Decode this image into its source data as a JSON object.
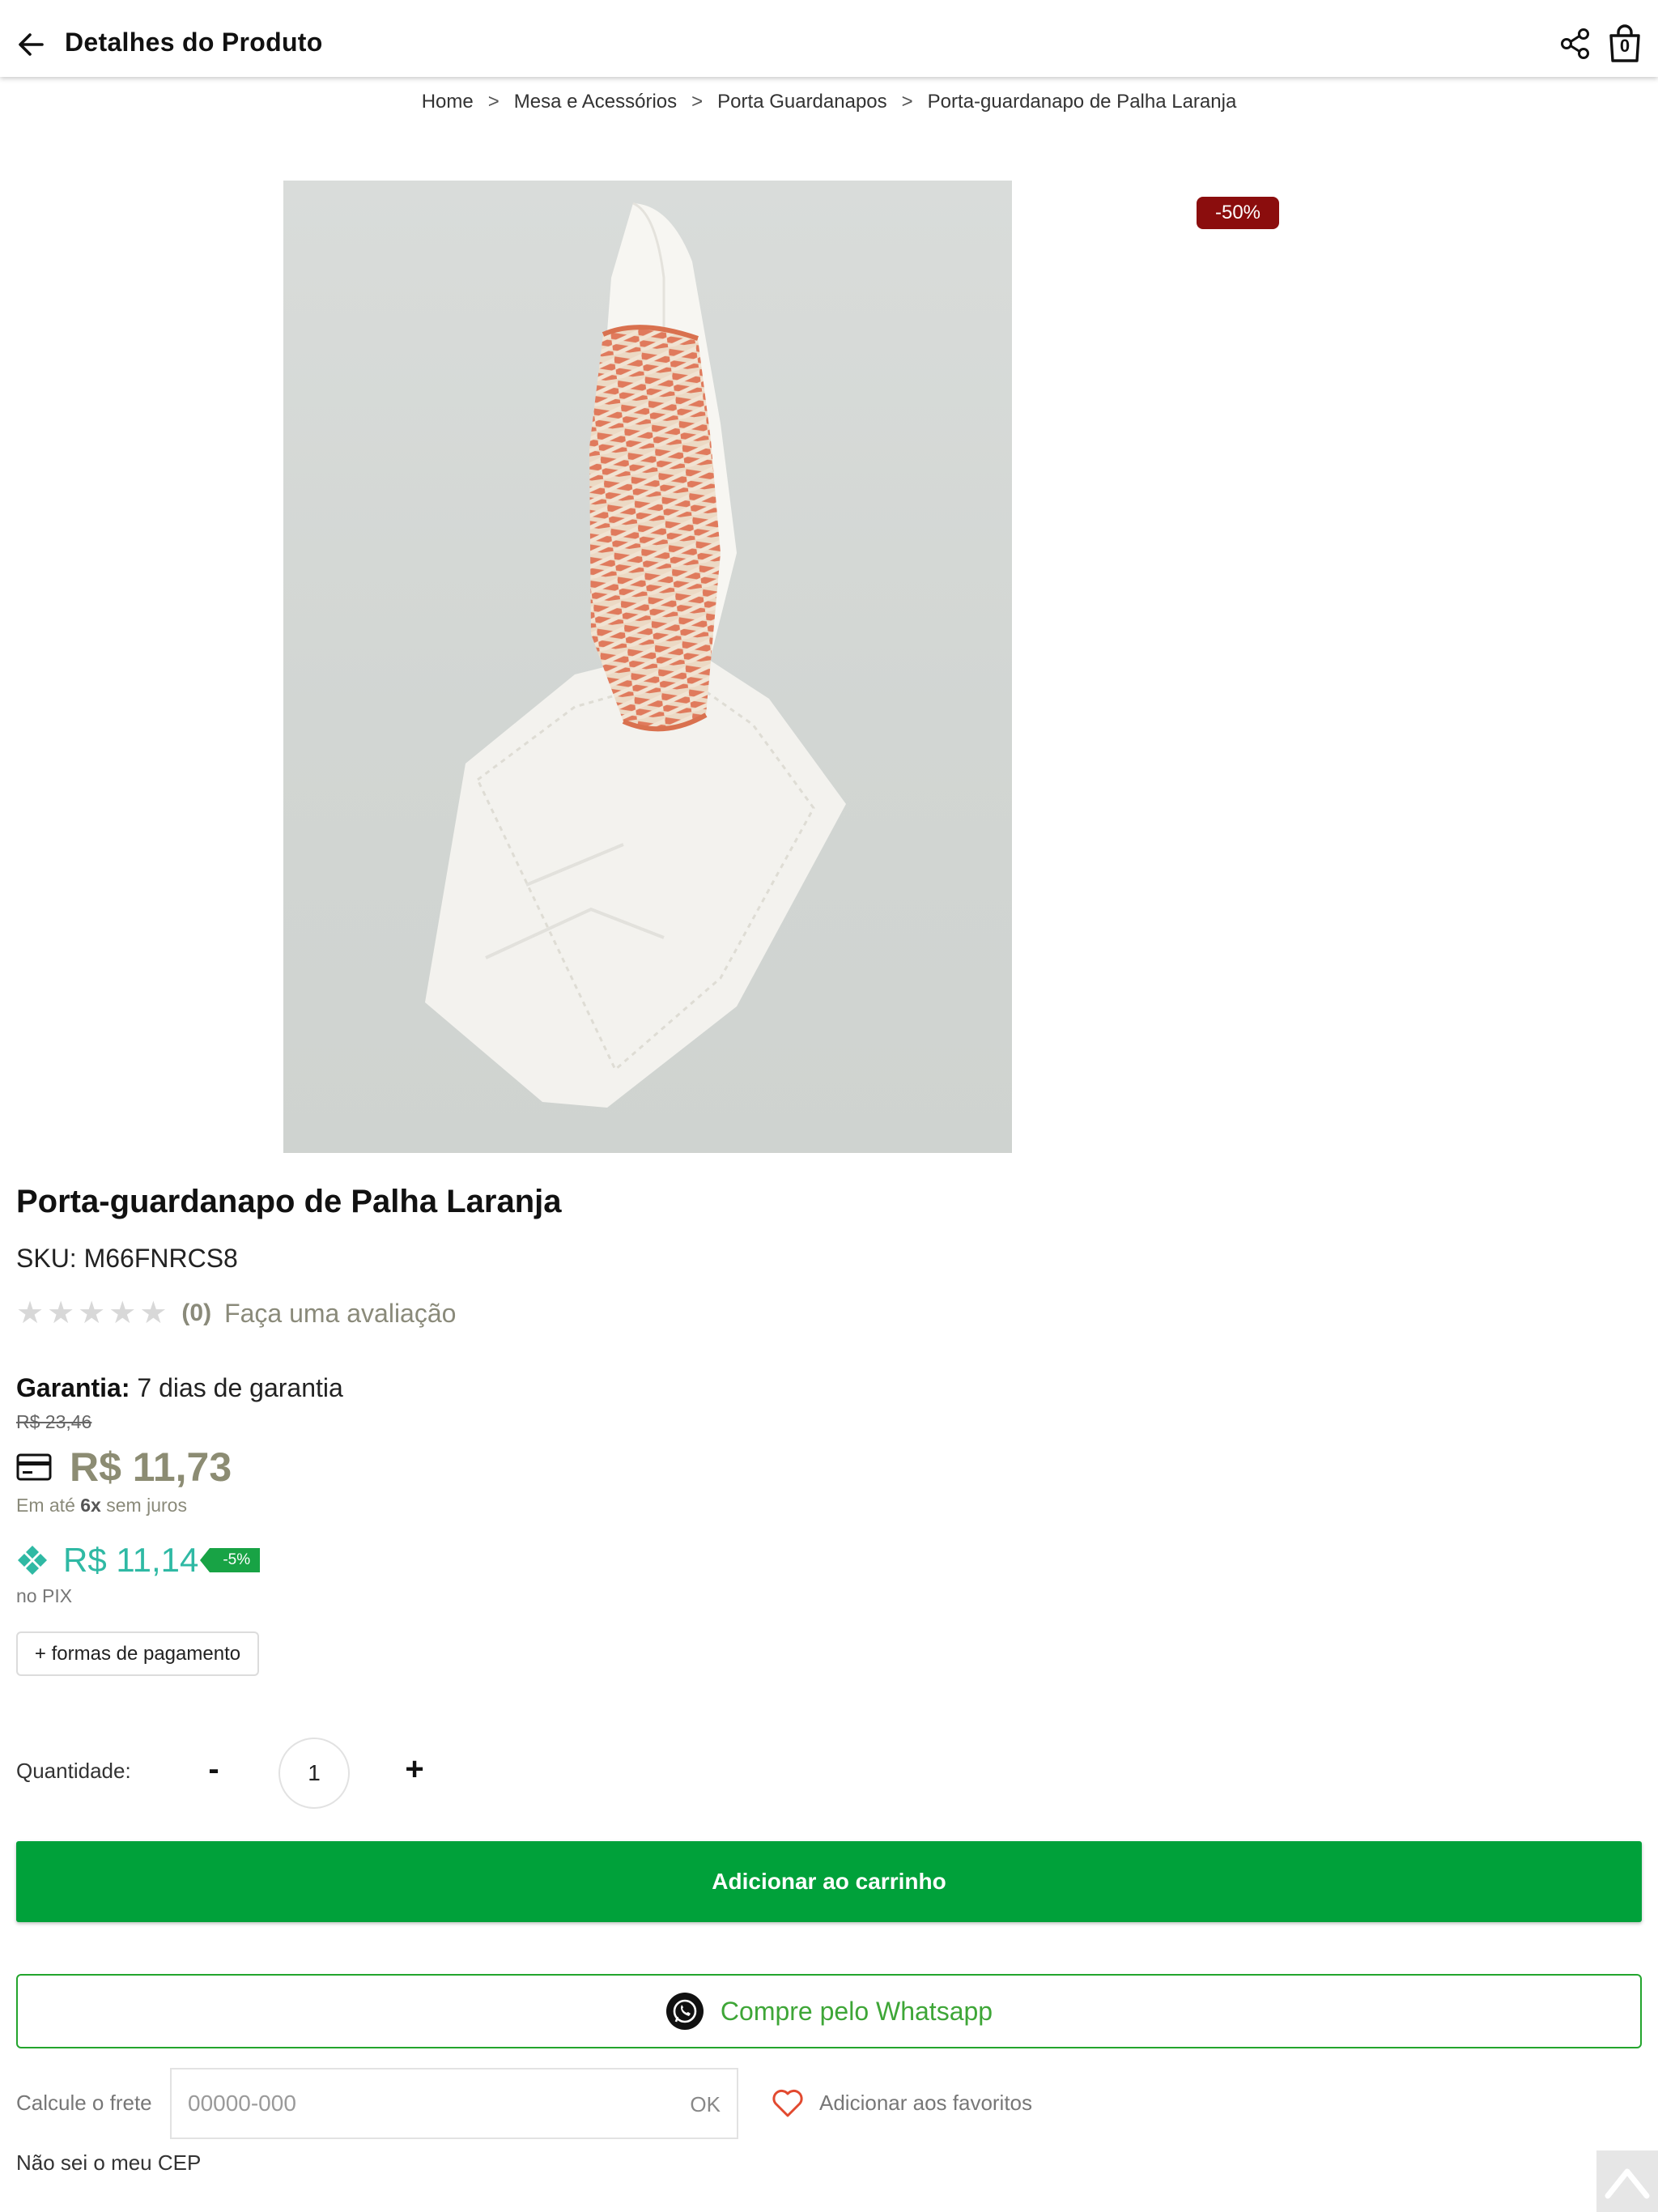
{
  "header": {
    "title": "Detalhes do Produto",
    "back_icon": "arrow-left-icon",
    "share_icon": "share-icon",
    "cart_icon": "shopping-bag-icon",
    "cart_count": "0"
  },
  "breadcrumb": {
    "items": [
      "Home",
      "Mesa e Acessórios",
      "Porta Guardanapos",
      "Porta-guardanapo de Palha Laranja"
    ],
    "separator": ">"
  },
  "product": {
    "discount_badge": "-50%",
    "name": "Porta-guardanapo de Palha Laranja",
    "sku_label": "SKU:",
    "sku": "M66FNRCS8",
    "rating": {
      "stars": 0,
      "max": 5,
      "count": "(0)",
      "review_link": "Faça uma avaliação"
    },
    "warranty_label": "Garantia:",
    "warranty_value": "7 dias de garantia",
    "old_price": "R$ 23,46",
    "card_price": "R$ 11,73",
    "installments_prefix": "Em até",
    "installments_count": "6x",
    "installments_suffix": "sem juros",
    "pix_price": "R$ 11,14",
    "pix_discount": "-5%",
    "pix_label": "no PIX",
    "payment_methods_button": "+ formas de pagamento"
  },
  "quantity": {
    "label": "Quantidade:",
    "minus": "-",
    "value": "1",
    "plus": "+"
  },
  "actions": {
    "add_to_cart": "Adicionar ao carrinho",
    "whatsapp": "Compre pelo Whatsapp",
    "freight_label": "Calcule o frete",
    "cep_placeholder": "00000-000",
    "cep_ok": "OK",
    "favorite": "Adicionar aos favoritos",
    "cep_help": "Não sei o meu CEP"
  },
  "colors": {
    "brand_green": "#00a13a",
    "whatsapp_green": "#23a52d",
    "discount_red": "#8b0d0d",
    "price_olive": "#8c8c73",
    "pix_teal": "#2fb9a4"
  }
}
